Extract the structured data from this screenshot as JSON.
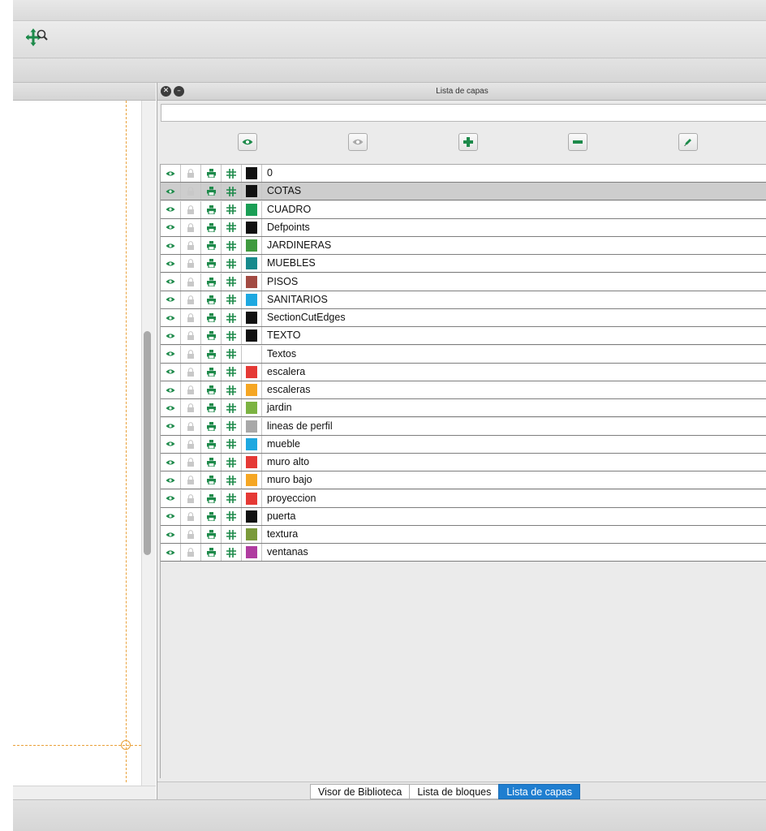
{
  "toolbar": {
    "pan_zoom_icon": "pan-zoom-icon"
  },
  "panel": {
    "title": "Lista de capas",
    "close_glyph": "✕",
    "minimize_glyph": "–",
    "filter_placeholder": ""
  },
  "actions": [
    {
      "name": "show-all-layers-button",
      "icon": "eye-icon"
    },
    {
      "name": "hide-all-layers-button",
      "icon": "eye-off-icon"
    },
    {
      "name": "add-layer-button",
      "icon": "plus-icon"
    },
    {
      "name": "remove-layer-button",
      "icon": "minus-icon"
    },
    {
      "name": "edit-layer-button",
      "icon": "pencil-icon"
    }
  ],
  "colors": {
    "icon_green": "#1d8a4a",
    "lock_gray": "#c8c8c8",
    "selected_row": "#cdcdcd",
    "active_tab": "#1f7ed0",
    "guide": "#e9a13a"
  },
  "layers": [
    {
      "name": "0",
      "color": "#111111"
    },
    {
      "name": "COTAS",
      "color": "#111111",
      "selected": true
    },
    {
      "name": "CUADRO",
      "color": "#1a9e55"
    },
    {
      "name": "Defpoints",
      "color": "#111111"
    },
    {
      "name": "JARDINERAS",
      "color": "#3f9a3f"
    },
    {
      "name": "MUEBLES",
      "color": "#178a8c"
    },
    {
      "name": "PISOS",
      "color": "#a24a42"
    },
    {
      "name": "SANITARIOS",
      "color": "#1ea8e0"
    },
    {
      "name": "SectionCutEdges",
      "color": "#111111"
    },
    {
      "name": "TEXTO",
      "color": "#111111"
    },
    {
      "name": "Textos",
      "color": "#ffffff"
    },
    {
      "name": "escalera",
      "color": "#e53935"
    },
    {
      "name": "escaleras",
      "color": "#f5a623"
    },
    {
      "name": "jardin",
      "color": "#7cb342"
    },
    {
      "name": "lineas de perfil",
      "color": "#a8a8a8"
    },
    {
      "name": "mueble",
      "color": "#1ea8e0"
    },
    {
      "name": "muro alto",
      "color": "#e53935"
    },
    {
      "name": "muro bajo",
      "color": "#f5a623"
    },
    {
      "name": "proyeccion",
      "color": "#e53935"
    },
    {
      "name": "puerta",
      "color": "#111111"
    },
    {
      "name": "textura",
      "color": "#7a9a3a"
    },
    {
      "name": "ventanas",
      "color": "#b03ca0"
    }
  ],
  "tabs": [
    {
      "label": "Visor de Biblioteca",
      "active": false
    },
    {
      "label": "Lista de bloques",
      "active": false
    },
    {
      "label": "Lista de capas",
      "active": true
    }
  ]
}
